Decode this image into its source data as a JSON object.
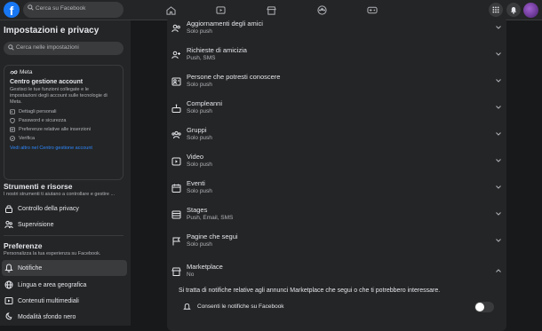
{
  "topbar": {
    "logo": "f",
    "search_placeholder": "Cerca su Facebook",
    "nav_icons": [
      "home-icon",
      "video-icon",
      "marketplace-icon",
      "groups-icon",
      "gaming-icon"
    ],
    "right_icons": [
      "menu-grid-icon",
      "notifications-bell-icon",
      "messenger-icon"
    ]
  },
  "sidebar": {
    "title": "Impostazioni e privacy",
    "search_placeholder": "Cerca nelle impostazioni",
    "meta_card": {
      "brand": "Meta",
      "title": "Centro gestione account",
      "description": "Gestisci le tue funzioni collegate e le impostazioni degli account sulle tecnologie di Meta.",
      "items": [
        "Dettagli personali",
        "Password e sicurezza",
        "Preferenze relative alle inserzioni",
        "Verifica"
      ],
      "link": "Vedi altro nel Centro gestione account"
    },
    "tools_section": {
      "title": "Strumenti e risorse",
      "subtitle": "I nostri strumenti ti aiutano a controllare e gestire ...",
      "items": [
        "Controllo della privacy",
        "Supervisione"
      ]
    },
    "prefs_section": {
      "title": "Preferenze",
      "subtitle": "Personalizza la tua esperienza su Facebook.",
      "items": [
        "Notifiche",
        "Lingua e area geografica",
        "Contenuti multimediali",
        "Modalità sfondo nero"
      ]
    }
  },
  "notifications": [
    {
      "title": "Aggiornamenti degli amici",
      "sub": "Solo push",
      "icon": "friends-icon"
    },
    {
      "title": "Richieste di amicizia",
      "sub": "Push, SMS",
      "icon": "add-friend-icon"
    },
    {
      "title": "Persone che potresti conoscere",
      "sub": "Solo push",
      "icon": "people-card-icon"
    },
    {
      "title": "Compleanni",
      "sub": "Solo push",
      "icon": "cake-icon"
    },
    {
      "title": "Gruppi",
      "sub": "Solo push",
      "icon": "groups-icon"
    },
    {
      "title": "Video",
      "sub": "Solo push",
      "icon": "video-icon"
    },
    {
      "title": "Eventi",
      "sub": "Solo push",
      "icon": "calendar-icon"
    },
    {
      "title": "Stages",
      "sub": "Push, Email, SMS",
      "icon": "stage-icon"
    },
    {
      "title": "Pagine che segui",
      "sub": "Solo push",
      "icon": "flag-icon"
    }
  ],
  "marketplace": {
    "title": "Marketplace",
    "sub": "No",
    "description": "Si tratta di notifiche relative agli annunci Marketplace che segui o che ti potrebbero interessare.",
    "toggle_label": "Consenti le notifiche su Facebook",
    "toggle_on": false
  }
}
